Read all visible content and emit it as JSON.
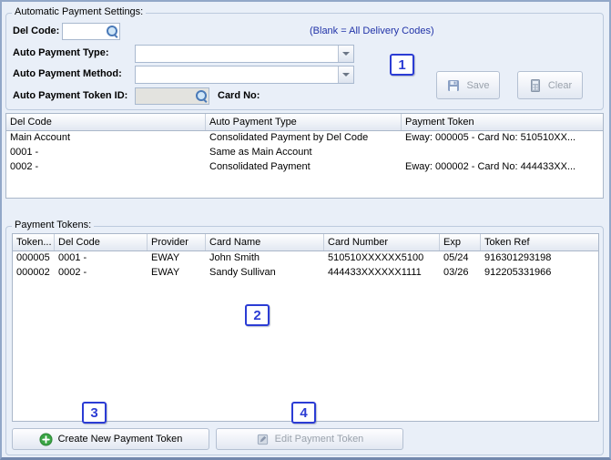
{
  "colors": {
    "callout_blue": "#2b3cd4",
    "hint_blue": "#2133a8",
    "window_bg": "#e9eff8"
  },
  "auto_settings": {
    "group_title": "Automatic Payment Settings:",
    "del_code_label": "Del Code:",
    "del_code_value": "",
    "blank_hint": "(Blank = All Delivery Codes)",
    "auto_payment_type_label": "Auto Payment Type:",
    "auto_payment_type_value": "",
    "auto_payment_method_label": "Auto Payment Method:",
    "auto_payment_method_value": "",
    "auto_payment_token_id_label": "Auto Payment Token ID:",
    "auto_payment_token_id_value": "",
    "card_no_label": "Card No:",
    "save_button": "Save",
    "clear_button": "Clear"
  },
  "upper_table": {
    "headers": [
      "Del Code",
      "Auto Payment Type",
      "Payment Token"
    ],
    "rows": [
      {
        "del_code": "Main Account",
        "auto_payment_type": "Consolidated Payment by Del Code",
        "payment_token": "Eway: 000005 - Card No: 510510XX..."
      },
      {
        "del_code": "0001 -",
        "auto_payment_type": "Same as Main Account",
        "payment_token": ""
      },
      {
        "del_code": "0002 -",
        "auto_payment_type": "Consolidated Payment",
        "payment_token": "Eway: 000002 - Card No: 444433XX..."
      }
    ]
  },
  "payment_tokens": {
    "group_title": "Payment Tokens:",
    "headers": [
      "Token...",
      "Del Code",
      "Provider",
      "Card Name",
      "Card Number",
      "Exp",
      "Token Ref"
    ],
    "rows": [
      {
        "token": "000005",
        "del_code": "0001 -",
        "provider": "EWAY",
        "card_name": "John Smith",
        "card_number": "510510XXXXXX5100",
        "exp": "05/24",
        "token_ref": "916301293198"
      },
      {
        "token": "000002",
        "del_code": "0002 -",
        "provider": "EWAY",
        "card_name": "Sandy Sullivan",
        "card_number": "444433XXXXXX1111",
        "exp": "03/26",
        "token_ref": "912205331966"
      }
    ],
    "create_button": "Create New Payment Token",
    "edit_button": "Edit Payment Token"
  },
  "callouts": {
    "c1": "1",
    "c2": "2",
    "c3": "3",
    "c4": "4"
  },
  "icons": {
    "search": "magnifier",
    "dropdown": "chevron-down",
    "save": "diskette",
    "clear": "calculator",
    "create": "plus-circle",
    "edit": "pencil"
  }
}
